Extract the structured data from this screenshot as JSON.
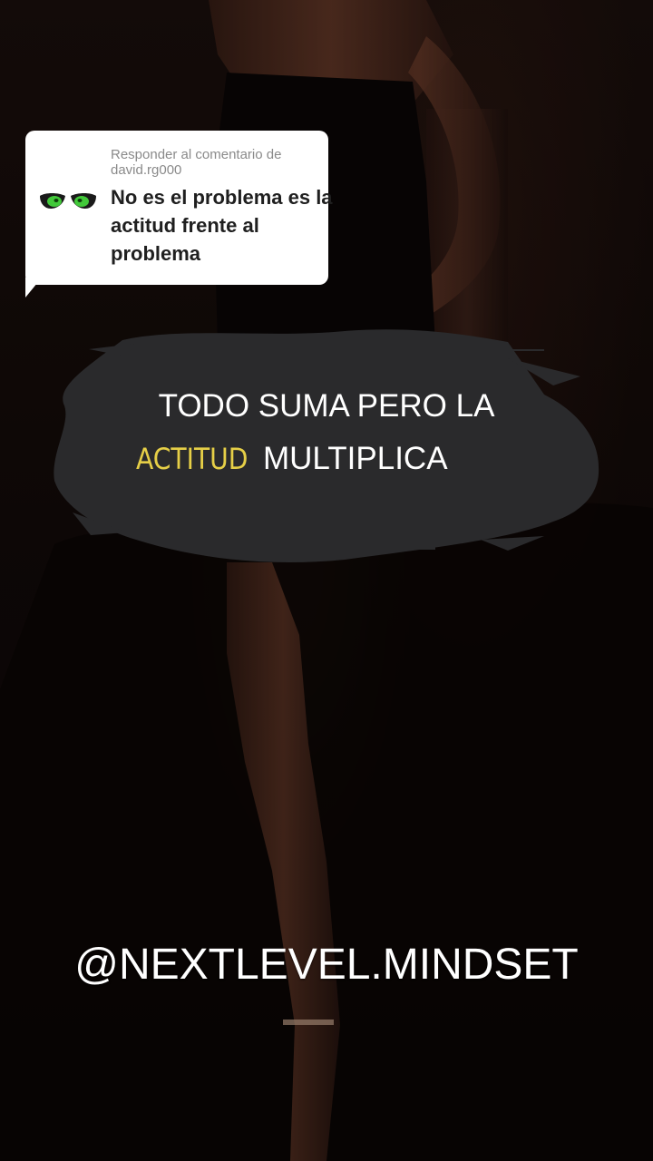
{
  "reply": {
    "header": "Responder al comentario de david.rg000",
    "emoji_icon": "eyes-icon",
    "comment": "No es el problema es la actitud frente al problema"
  },
  "quote": {
    "line1": "TODO SUMA PERO LA",
    "highlight_word": "ACTITUD",
    "line2_rest": "MULTIPLICA"
  },
  "handle": "@NEXTLEVEL.MINDSET",
  "colors": {
    "highlight": "#e6cf47",
    "brush": "#2a2a2c",
    "card": "#ffffff"
  }
}
